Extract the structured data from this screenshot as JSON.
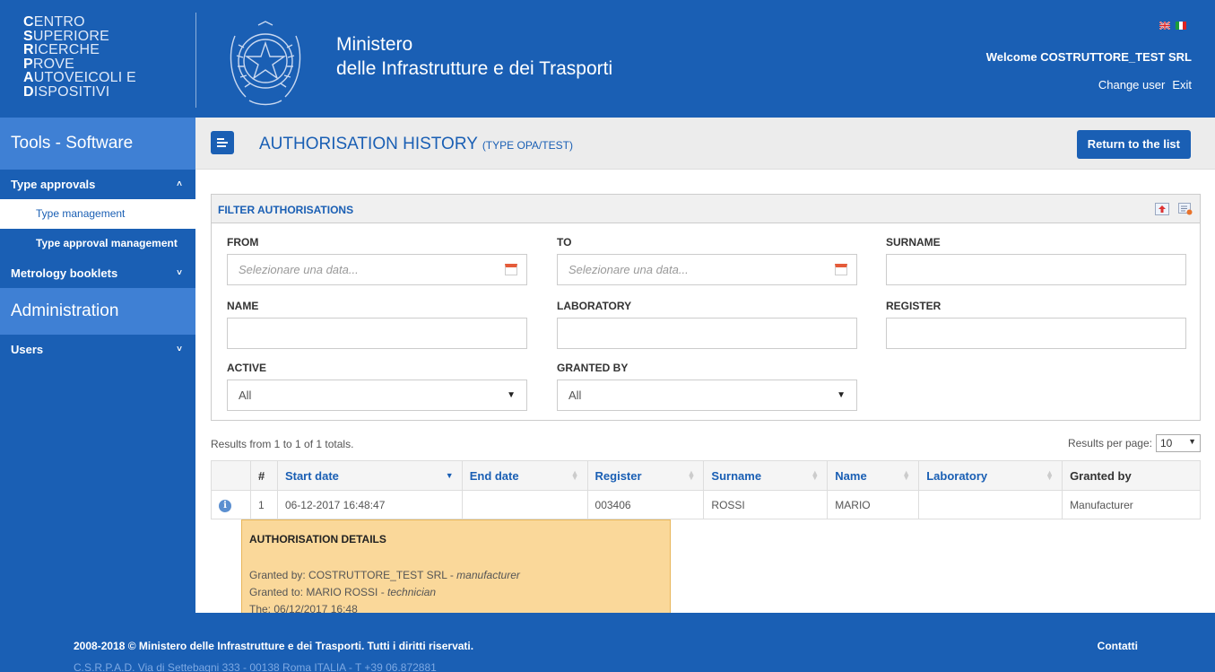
{
  "header": {
    "logo_lines": [
      {
        "initial": "C",
        "rest": "ENTRO"
      },
      {
        "initial": "S",
        "rest": "UPERIORE"
      },
      {
        "initial": "R",
        "rest": "ICERCHE"
      },
      {
        "initial": "P",
        "rest": "ROVE"
      },
      {
        "initial": "A",
        "rest": "UTOVEICOLI E"
      },
      {
        "initial": "D",
        "rest": "ISPOSITIVI"
      }
    ],
    "ministry_line1": "Ministero",
    "ministry_line2": "delle Infrastrutture e dei Trasporti",
    "welcome": "Welcome COSTRUTTORE_TEST SRL",
    "change_user": "Change user",
    "exit": "Exit",
    "emblem_icon": "emblem-icon",
    "flags": [
      "uk-flag-icon",
      "italy-flag-icon"
    ]
  },
  "sidebar": {
    "section_tools": "Tools - Software",
    "group_type_approvals": "Type approvals",
    "item_type_management": "Type management",
    "item_type_approval_management": "Type approval management",
    "group_metrology": "Metrology booklets",
    "section_admin": "Administration",
    "group_users": "Users"
  },
  "titlebar": {
    "title": "AUTHORISATION HISTORY",
    "subtitle": "(TYPE OPA/TEST)",
    "return_button": "Return to the list"
  },
  "filter": {
    "title": "FILTER AUTHORISATIONS",
    "from_label": "FROM",
    "to_label": "TO",
    "surname_label": "SURNAME",
    "name_label": "NAME",
    "laboratory_label": "LABORATORY",
    "register_label": "REGISTER",
    "active_label": "ACTIVE",
    "granted_by_label": "GRANTED BY",
    "date_placeholder": "Selezionare una data...",
    "active_value": "All",
    "granted_by_value": "All"
  },
  "results": {
    "info": "Results from 1 to 1 of 1 totals.",
    "per_page_label": "Results per page:",
    "per_page_value": "10",
    "columns": [
      "#",
      "Start date",
      "End date",
      "Register",
      "Surname",
      "Name",
      "Laboratory",
      "Granted by"
    ],
    "rows": [
      {
        "num": "1",
        "start_date": "06-12-2017 16:48:47",
        "end_date": "",
        "register": "003406",
        "surname": "ROSSI",
        "name": "MARIO",
        "laboratory": "",
        "granted_by": "Manufacturer"
      }
    ]
  },
  "tooltip": {
    "title": "AUTHORISATION DETAILS",
    "granted_by_prefix": "Granted by: COSTRUTTORE_TEST SRL - ",
    "granted_by_role": "manufacturer",
    "granted_to_prefix": "Granted to: MARIO ROSSI - ",
    "granted_to_role": "technician",
    "date_line": "The: 06/12/2017 16:48"
  },
  "footer": {
    "copyright": "2008-2018 © Ministero delle Infrastrutture e dei Trasporti. Tutti i diritti riservati.",
    "address": "C.S.R.P.A.D. Via di Settebagni 333 - 00138 Roma ITALIA - T +39 06.872881",
    "contatti": "Contatti"
  },
  "colors": {
    "brand_blue": "#1a5fb4",
    "sidebar_section": "#3f80d4",
    "tooltip_bg": "#fad89a"
  }
}
